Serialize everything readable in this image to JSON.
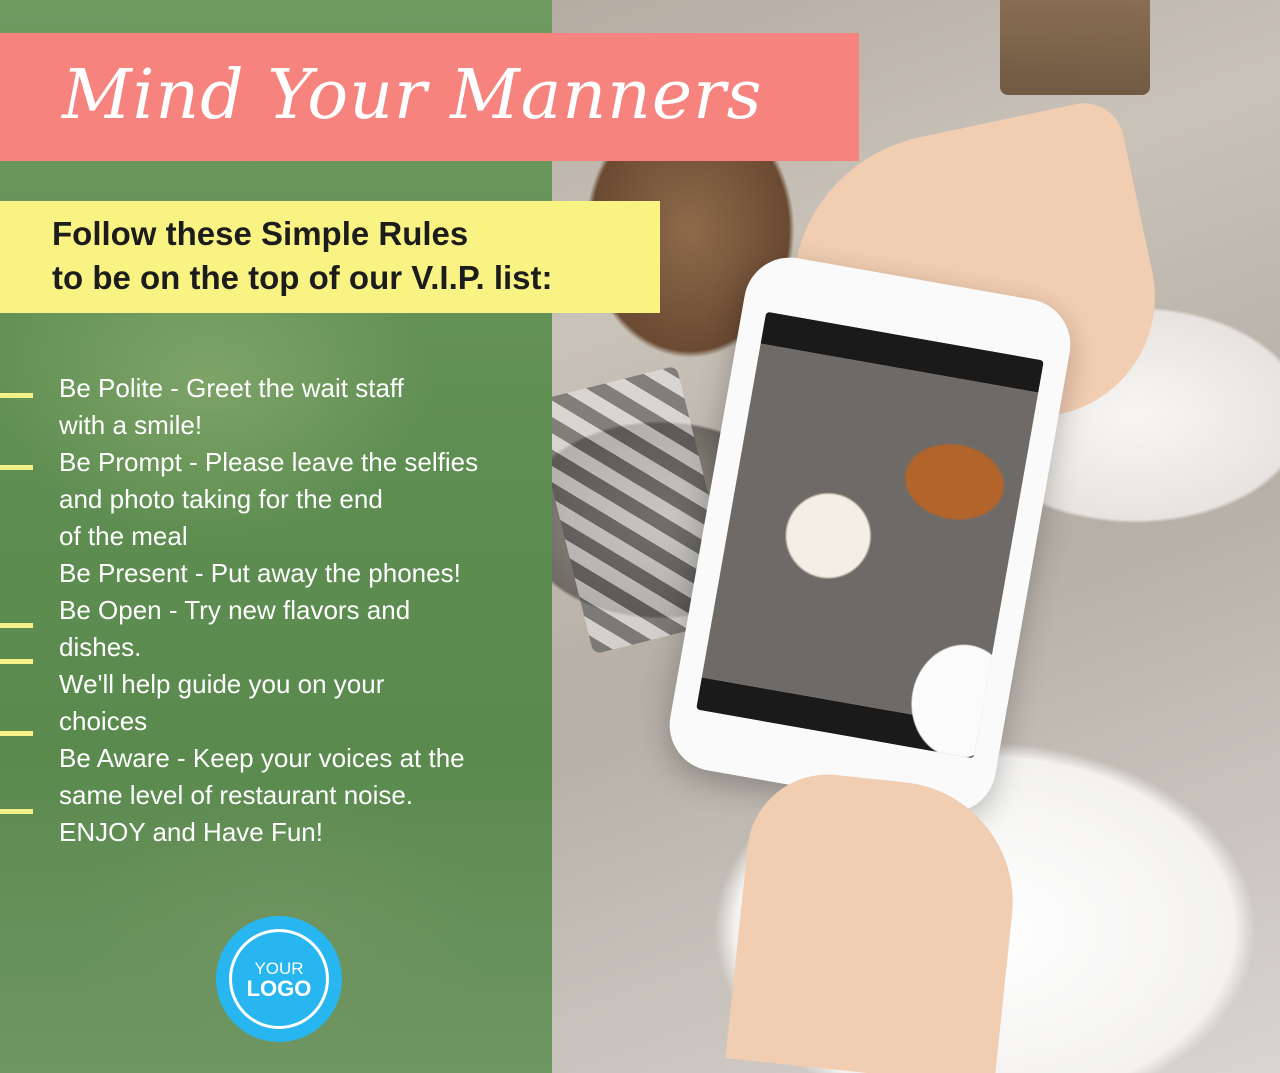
{
  "title": "Mind Your Manners",
  "subtitle": {
    "line1": "Follow these Simple Rules",
    "line2": "to be on the top of our V.I.P. list:"
  },
  "rules": [
    "Be Polite - Greet the wait staff",
    "with a smile!",
    "Be Prompt - Please leave the selfies",
    "and photo taking for the end",
    "of the meal",
    "Be Present - Put away the phones!",
    "Be Open - Try new flavors and",
    "dishes.",
    "We'll help guide you on your",
    "choices",
    "Be Aware - Keep your voices at the",
    "same level of restaurant noise.",
    "ENJOY and Have Fun!"
  ],
  "logo": {
    "top": "YOUR",
    "bottom": "LOGO"
  },
  "colors": {
    "title_banner": "#f6837e",
    "subtitle_banner": "#f9f383",
    "panel": "#5f8e52",
    "logo": "#28b6f0"
  }
}
